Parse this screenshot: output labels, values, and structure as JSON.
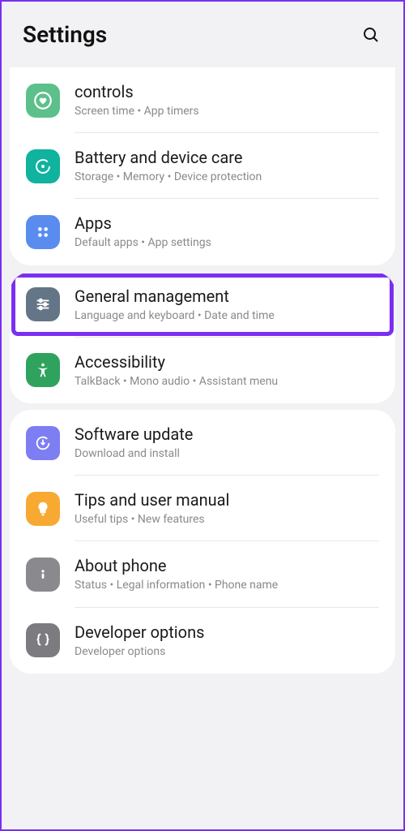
{
  "header": {
    "title": "Settings"
  },
  "groups": [
    {
      "items": [
        {
          "id": "controls",
          "title": "controls",
          "subtitle": "Screen time  •  App timers",
          "icon": "heart-circle",
          "color": "green"
        },
        {
          "id": "battery",
          "title": "Battery and device care",
          "subtitle": "Storage  •  Memory  •  Device protection",
          "icon": "refresh",
          "color": "teal"
        },
        {
          "id": "apps",
          "title": "Apps",
          "subtitle": "Default apps  •  App settings",
          "icon": "grid",
          "color": "blue"
        }
      ]
    },
    {
      "items": [
        {
          "id": "general",
          "title": "General management",
          "subtitle": "Language and keyboard  •  Date and time",
          "icon": "sliders",
          "color": "slate",
          "highlighted": true
        },
        {
          "id": "accessibility",
          "title": "Accessibility",
          "subtitle": "TalkBack  •  Mono audio  •  Assistant menu",
          "icon": "person",
          "color": "green2"
        }
      ]
    },
    {
      "items": [
        {
          "id": "software",
          "title": "Software update",
          "subtitle": "Download and install",
          "icon": "download-circle",
          "color": "indigo"
        },
        {
          "id": "tips",
          "title": "Tips and user manual",
          "subtitle": "Useful tips  •  New features",
          "icon": "bulb",
          "color": "orange"
        },
        {
          "id": "about",
          "title": "About phone",
          "subtitle": "Status  •  Legal information  •  Phone name",
          "icon": "info",
          "color": "gray"
        },
        {
          "id": "dev",
          "title": "Developer options",
          "subtitle": "Developer options",
          "icon": "braces",
          "color": "gray2"
        }
      ]
    }
  ]
}
